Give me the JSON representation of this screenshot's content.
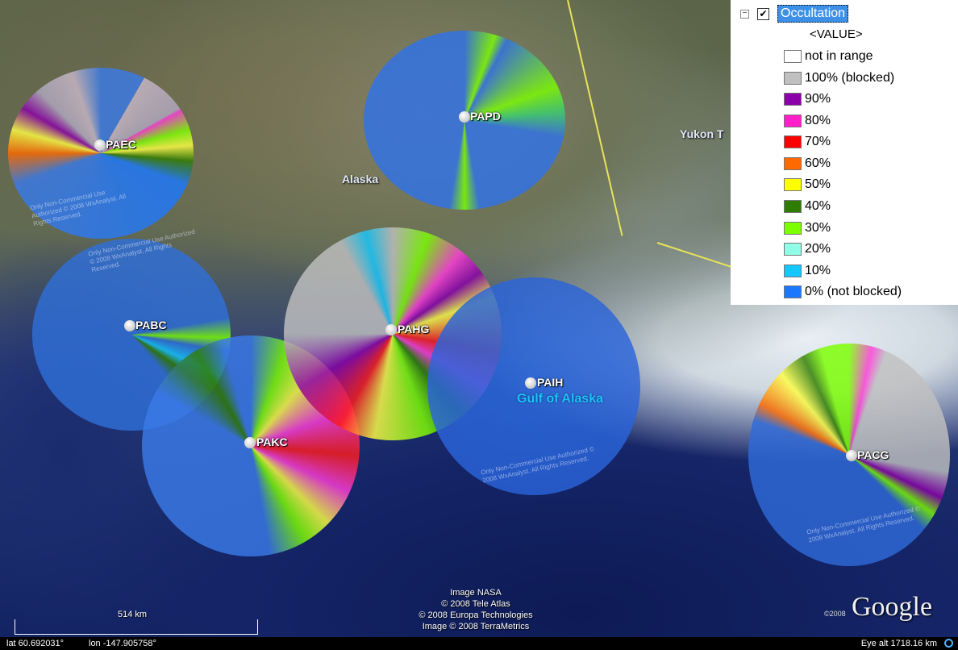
{
  "legend": {
    "title": "Occultation",
    "value_label": "<VALUE>",
    "checked": true,
    "items": [
      {
        "label": "not in range",
        "color": "#ffffff"
      },
      {
        "label": "100% (blocked)",
        "color": "#c0c0c0"
      },
      {
        "label": "90%",
        "color": "#8b00a8"
      },
      {
        "label": "80%",
        "color": "#ff1ec8"
      },
      {
        "label": "70%",
        "color": "#ff0000"
      },
      {
        "label": "60%",
        "color": "#ff6a00"
      },
      {
        "label": "50%",
        "color": "#ffff00"
      },
      {
        "label": "40%",
        "color": "#2f7d00"
      },
      {
        "label": "30%",
        "color": "#7cff00"
      },
      {
        "label": "20%",
        "color": "#8fffe8"
      },
      {
        "label": "10%",
        "color": "#14c8ff"
      },
      {
        "label": "0% (not blocked)",
        "color": "#1a78ff"
      }
    ]
  },
  "sites": [
    {
      "id": "PAEC"
    },
    {
      "id": "PAPD"
    },
    {
      "id": "PABC"
    },
    {
      "id": "PAHG"
    },
    {
      "id": "PAKC"
    },
    {
      "id": "PAIH"
    },
    {
      "id": "PACG"
    }
  ],
  "places": {
    "alaska": "Alaska",
    "yukon": "Yukon T",
    "gulf": "Gulf of Alaska"
  },
  "watermark": "Only Non-Commercial Use Authorized © 2008 WxAnalyst. All Rights Reserved.",
  "credits": [
    "Image NASA",
    "© 2008 Tele Atlas",
    "© 2008 Europa Technologies",
    "Image © 2008 TerraMetrics"
  ],
  "google": {
    "logo": "Google",
    "year": "©2008"
  },
  "scale": {
    "label": "514 km"
  },
  "status": {
    "lat": "lat   60.692031°",
    "lon": "lon -147.905758°",
    "alt": "Eye alt   1718.16 km"
  }
}
